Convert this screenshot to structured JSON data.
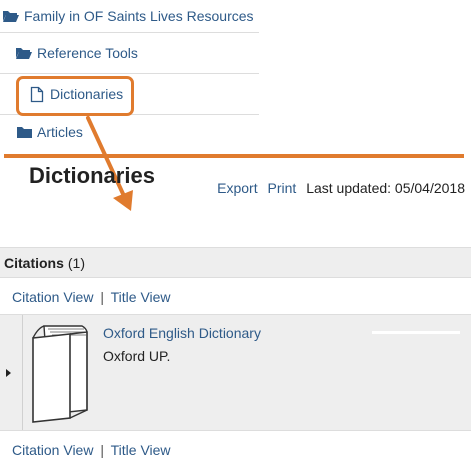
{
  "tree": {
    "items": [
      {
        "label": "Family in OF Saints Lives Resources",
        "icon": "folder-open-icon"
      },
      {
        "label": "Reference Tools",
        "icon": "folder-open-icon"
      },
      {
        "label": "Dictionaries",
        "icon": "file-icon"
      },
      {
        "label": "Articles",
        "icon": "folder-icon"
      }
    ]
  },
  "page": {
    "title": "Dictionaries",
    "export_label": "Export",
    "print_label": "Print",
    "last_updated": "Last updated: 05/04/2018"
  },
  "citations": {
    "heading": "Citations",
    "count": "(1)",
    "citation_view_label": "Citation View",
    "separator": "|",
    "title_view_label": "Title View",
    "items": [
      {
        "title": "Oxford English Dictionary",
        "publisher": "Oxford UP.",
        "icon": "book-icon"
      }
    ]
  },
  "colors": {
    "link": "#2e5a88",
    "annotation": "#e07b2e",
    "panel": "#eeeeee"
  }
}
